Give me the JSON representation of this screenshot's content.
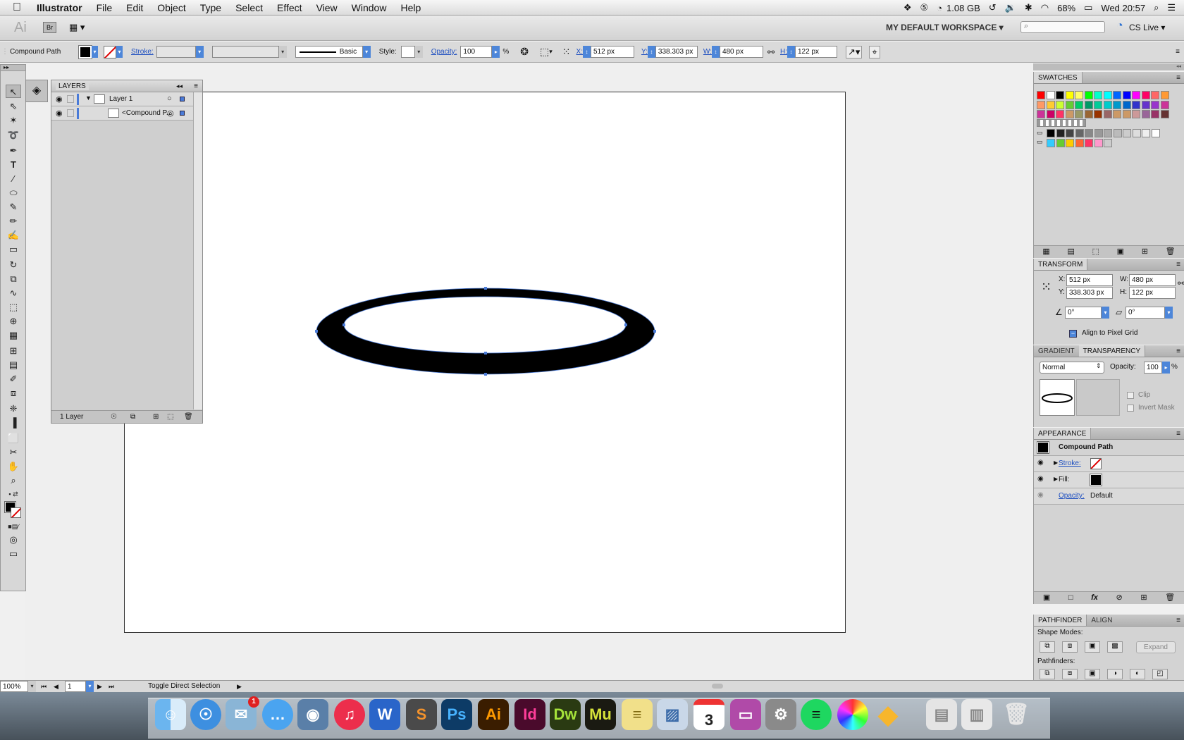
{
  "menubar": {
    "apple_icon": "apple-logo",
    "app_name": "Illustrator",
    "items": [
      "File",
      "Edit",
      "Object",
      "Type",
      "Select",
      "Effect",
      "View",
      "Window",
      "Help"
    ],
    "memory": "1.08 GB",
    "battery": "68%",
    "clock": "Wed 20:57"
  },
  "appbar": {
    "logo": "Ai",
    "bridge": "Br",
    "workspace": "MY DEFAULT WORKSPACE ▾",
    "cs_live": "CS Live ▾"
  },
  "control": {
    "selection_type": "Compound Path",
    "stroke_label": "Stroke:",
    "brush_label": "Basic",
    "style_label": "Style:",
    "opacity_label": "Opacity:",
    "opacity_value": "100",
    "percent": "%",
    "x_label": "X:",
    "x_value": "512 px",
    "y_label": "Y:",
    "y_value": "338.303 px",
    "w_label": "W:",
    "w_value": "480 px",
    "h_label": "H:",
    "h_value": "122 px"
  },
  "layers": {
    "title": "LAYERS",
    "layer_name": "Layer 1",
    "sublayer_name": "<Compound P...",
    "footer": "1 Layer"
  },
  "swatches": {
    "title": "SWATCHES",
    "row1": [
      "#ff0000",
      "#ffffff",
      "#000000",
      "#ffff00",
      "#ffff66",
      "#00ff00",
      "#00ffcc",
      "#00ffff",
      "#0066ff",
      "#0000ff",
      "#ff00ff",
      "#ff0066",
      "#ff6666",
      "#ff9933"
    ],
    "row2": [
      "#ff9966",
      "#ffcc33",
      "#ccff33",
      "#66cc33",
      "#00cc66",
      "#009966",
      "#00cc99",
      "#00cccc",
      "#0099cc",
      "#0066cc",
      "#3333cc",
      "#6633cc",
      "#9933cc",
      "#cc3399"
    ],
    "row3": [
      "#cc3399",
      "#cc0066",
      "#ff3366",
      "#cc9966",
      "#999966",
      "#996633",
      "#993300",
      "#996666",
      "#cc9966",
      "#cc9966",
      "#cc9999",
      "#996699",
      "#993366",
      "#663333"
    ],
    "row5": [
      "#000000",
      "#222222",
      "#444444",
      "#666666",
      "#888888",
      "#999999",
      "#aaaaaa",
      "#bbbbbb",
      "#cccccc",
      "#dddddd",
      "#eeeeee",
      "#ffffff"
    ],
    "row6": [
      "#33ccff",
      "#66cc33",
      "#ffcc00",
      "#ff6633",
      "#ff3366",
      "#ff99cc",
      "#cccccc"
    ]
  },
  "transform": {
    "title": "TRANSFORM",
    "x_label": "X:",
    "x_value": "512 px",
    "y_label": "Y:",
    "y_value": "338.303 px",
    "w_label": "W:",
    "w_value": "480 px",
    "h_label": "H:",
    "h_value": "122 px",
    "rotate_value": "0°",
    "shear_value": "0°",
    "pixel_grid": "Align to Pixel Grid"
  },
  "transparency": {
    "tab1": "GRADIENT",
    "tab2": "TRANSPARENCY",
    "blend_mode": "Normal",
    "opacity_label": "Opacity:",
    "opacity_value": "100",
    "percent": "%",
    "clip": "Clip",
    "invert": "Invert Mask"
  },
  "appearance": {
    "title": "APPEARANCE",
    "object": "Compound Path",
    "stroke": "Stroke:",
    "fill": "Fill:",
    "opacity": "Opacity:",
    "opacity_value": "Default"
  },
  "pathfinder": {
    "tab1": "PATHFINDER",
    "tab2": "ALIGN",
    "shape_modes": "Shape Modes:",
    "expand": "Expand",
    "pathfinders": "Pathfinders:"
  },
  "status": {
    "zoom": "100%",
    "artboard": "1",
    "message": "Toggle Direct Selection"
  },
  "dock": {
    "apps": [
      "Finder",
      "Safari",
      "Mail",
      "Messages",
      "iPhoto",
      "iTunes",
      "Word",
      "Sublime",
      "Ps",
      "Ai",
      "Id",
      "Dw",
      "Mu",
      "Stickies",
      "Preview",
      "Calendar",
      "iMac",
      "System Preferences",
      "Spotify",
      "Colors",
      "Sketch",
      "Documents",
      "Trash"
    ],
    "mail_badge": "1",
    "calendar_day": "3"
  }
}
